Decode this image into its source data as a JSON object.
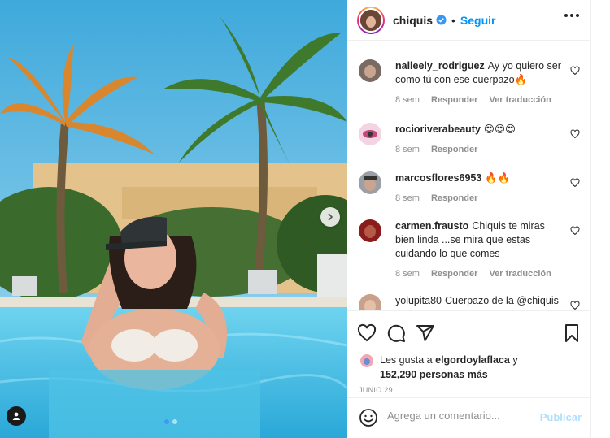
{
  "post": {
    "username": "chiquis",
    "follow_label": "Seguir",
    "separator": "•"
  },
  "comments": [
    {
      "username": "nalleely_rodriguez",
      "text": "Ay yo quiero ser como tú con ese cuerpazo🔥",
      "time": "8 sem",
      "reply_label": "Responder",
      "translate_label": "Ver traducción",
      "avatar_color": "#7a6a64"
    },
    {
      "username": "rocioriverabeauty",
      "text": "😍😍😍",
      "time": "8 sem",
      "reply_label": "Responder",
      "avatar_color": "#e7a9c4"
    },
    {
      "username": "marcosflores6953",
      "text": "🔥🔥",
      "time": "8 sem",
      "reply_label": "Responder",
      "avatar_color": "#5f6368"
    },
    {
      "username": "carmen.frausto",
      "text": "Chiquis te miras bien linda ...se mira que estas cuidando lo que comes",
      "time": "8 sem",
      "reply_label": "Responder",
      "translate_label": "Ver traducción",
      "avatar_color": "#8b1c1c"
    },
    {
      "username": "yolupita80",
      "text": "Cuerpazo de la @chiquis",
      "avatar_color": "#c9a08a"
    }
  ],
  "likes": {
    "prefix": "Les gusta a",
    "user": "elgordoylaflaca",
    "connector": "y",
    "count_text": "152,290 personas más"
  },
  "date": "JUNIO 29",
  "composer": {
    "placeholder": "Agrega un comentario...",
    "publish_label": "Publicar"
  },
  "colors": {
    "accent": "#0095f6",
    "publish_disabled": "#b2dffc",
    "muted": "#8e8e8e",
    "verified": "#3897f0"
  },
  "icons": {
    "like": "heart-icon",
    "comment": "comment-icon",
    "share": "share-icon",
    "save": "bookmark-icon",
    "emoji": "emoji-icon",
    "next": "chevron-right-icon",
    "tag": "user-tag-icon"
  }
}
